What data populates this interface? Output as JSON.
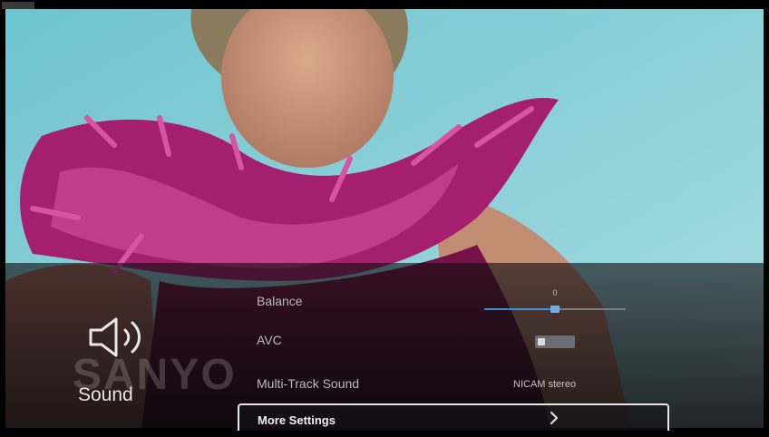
{
  "menu": {
    "category": "Sound",
    "category_icon": "speaker-icon",
    "brand_watermark": "SANYO",
    "items": {
      "balance": {
        "label": "Balance",
        "value": "0",
        "level": 0.5
      },
      "avc": {
        "label": "AVC",
        "state": "off"
      },
      "multi_track": {
        "label": "Multi-Track Sound",
        "value": "NICAM stereo"
      },
      "more_settings": {
        "label": "More Settings",
        "icon": "chevron-right-icon"
      }
    }
  },
  "colors": {
    "accent": "#3f8fd0",
    "panel_background": "#141014",
    "focus_border": "#e6e6e6"
  }
}
